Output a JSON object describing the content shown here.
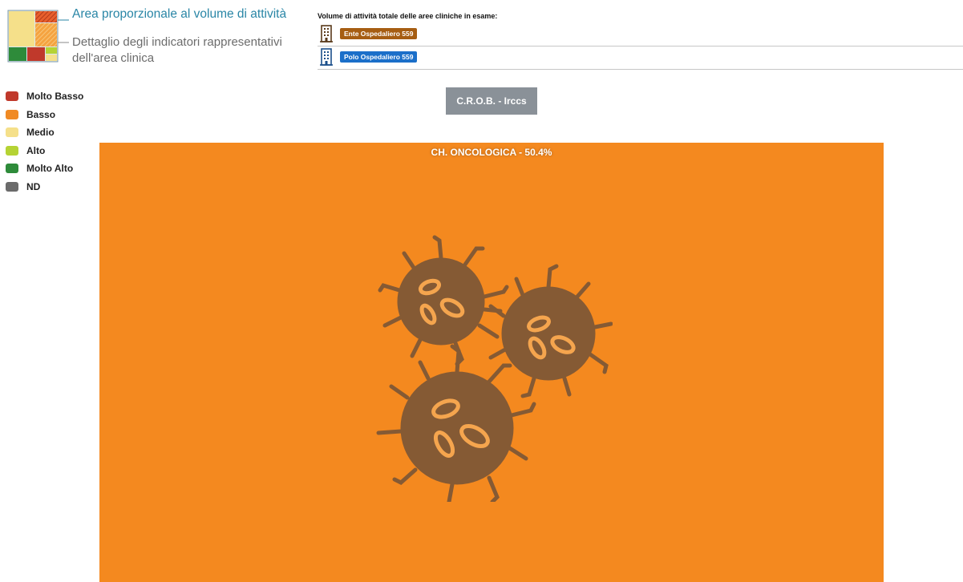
{
  "explain": {
    "area_text": "Area proporzionale al volume di attività",
    "detail_text": "Dettaglio degli indicatori rappresentativi dell'area clinica"
  },
  "totals": {
    "title": "Volume di attività totale delle aree cliniche in esame:",
    "rows": [
      {
        "label": "Ente Ospedaliero 559",
        "color": "#a65d12"
      },
      {
        "label": "Polo Ospedaliero 559",
        "color": "#1b6fc9"
      }
    ]
  },
  "legend": [
    {
      "label": "Molto Basso",
      "color": "#c0392b"
    },
    {
      "label": "Basso",
      "color": "#f08a24"
    },
    {
      "label": "Medio",
      "color": "#f5e08a"
    },
    {
      "label": "Alto",
      "color": "#b5d334"
    },
    {
      "label": "Molto Alto",
      "color": "#2e8b3a"
    },
    {
      "label": "ND",
      "color": "#6b6b6b"
    }
  ],
  "structure": {
    "label": "C.R.O.B. - Irccs"
  },
  "cell": {
    "title": "CH. ONCOLOGICA - 50.4%",
    "color": "#f4891f",
    "icon": "cancer-cells-icon"
  }
}
